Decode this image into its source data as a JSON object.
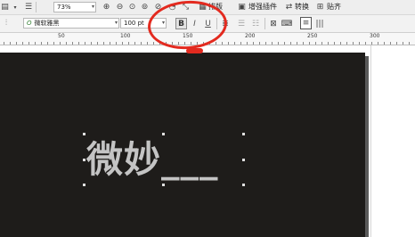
{
  "toolbar_top": {
    "zoom": "73%",
    "text_buttons": [
      {
        "label": "排版"
      },
      {
        "label": "增强插件"
      },
      {
        "label": "转换"
      },
      {
        "label": "贴齐"
      }
    ]
  },
  "toolbar_text": {
    "font_name": "微软雅黑",
    "font_size": "100 pt",
    "bold_glyph": "B",
    "italic_glyph": "I",
    "underline_glyph": "U"
  },
  "ruler": {
    "labels": [
      "50",
      "100",
      "150",
      "200",
      "250",
      "300"
    ]
  },
  "canvas": {
    "text": "微妙___"
  },
  "annotation": {
    "color": "#e32a1f"
  }
}
